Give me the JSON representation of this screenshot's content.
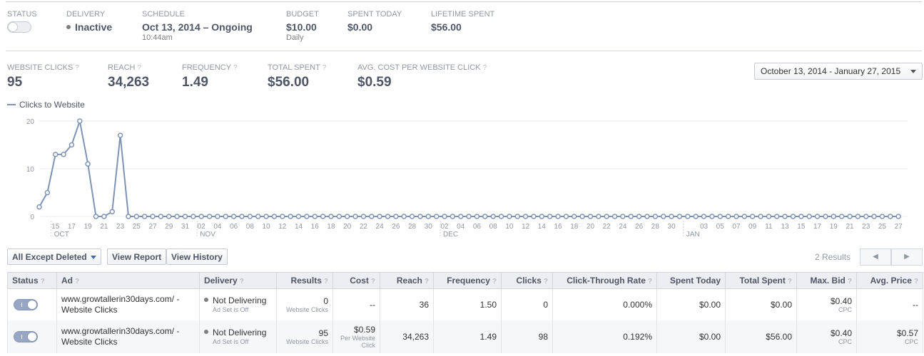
{
  "summary": {
    "status_label": "STATUS",
    "delivery_label": "DELIVERY",
    "delivery_value": "Inactive",
    "schedule_label": "SCHEDULE",
    "schedule_value": "Oct 13, 2014 – Ongoing",
    "schedule_time": "10:44am",
    "budget_label": "BUDGET",
    "budget_value": "$10.00",
    "budget_sub": "Daily",
    "spent_today_label": "SPENT TODAY",
    "spent_today_value": "$0.00",
    "lifetime_label": "LIFETIME SPENT",
    "lifetime_value": "$56.00"
  },
  "stats": [
    {
      "label": "WEBSITE CLICKS",
      "value": "95"
    },
    {
      "label": "REACH",
      "value": "34,263"
    },
    {
      "label": "FREQUENCY",
      "value": "1.49"
    },
    {
      "label": "TOTAL SPENT",
      "value": "$56.00"
    },
    {
      "label": "AVG. COST PER WEBSITE CLICK",
      "value": "$0.59"
    }
  ],
  "help_mark": "?",
  "date_range": "October 13, 2014 - January 27, 2015",
  "chart_data": {
    "type": "line",
    "series": [
      {
        "name": "Clicks to Website",
        "values": [
          2,
          5,
          13,
          13,
          15,
          20,
          11,
          0,
          0,
          1,
          17,
          0,
          0,
          0,
          0,
          0,
          0,
          0,
          0,
          0,
          0,
          0,
          0,
          0,
          0,
          0,
          0,
          0,
          0,
          0,
          0,
          0,
          0,
          0,
          0,
          0,
          0,
          0,
          0,
          0,
          0,
          0,
          0,
          0,
          0,
          0,
          0,
          0,
          0,
          0,
          0,
          0,
          0,
          0,
          0,
          0,
          0,
          0,
          0,
          0,
          0,
          0,
          0,
          0,
          0,
          0,
          0,
          0,
          0,
          0,
          0,
          0,
          0,
          0,
          0,
          0,
          0,
          0,
          0,
          0,
          0,
          0,
          0,
          0,
          0,
          0,
          0,
          0,
          0,
          0,
          0,
          0,
          0,
          0,
          0,
          0,
          0,
          0,
          0,
          0,
          0,
          0,
          0,
          0,
          0,
          0,
          0
        ]
      }
    ],
    "ylim": [
      0,
      20
    ],
    "yticks": [
      "0",
      "10",
      "20"
    ],
    "xticks": [
      "15",
      "17",
      "19",
      "21",
      "23",
      "25",
      "27",
      "29",
      "31",
      "02",
      "04",
      "06",
      "08",
      "10",
      "12",
      "14",
      "16",
      "18",
      "20",
      "22",
      "24",
      "26",
      "28",
      "30",
      "02",
      "04",
      "06",
      "08",
      "10",
      "12",
      "14",
      "16",
      "18",
      "20",
      "22",
      "24",
      "26",
      "28",
      "30",
      "",
      "03",
      "05",
      "07",
      "09",
      "11",
      "13",
      "15",
      "17",
      "19",
      "21",
      "23",
      "25",
      "27"
    ],
    "months": [
      {
        "label": "OCT",
        "tick": 0
      },
      {
        "label": "NOV",
        "tick": 9
      },
      {
        "label": "DEC",
        "tick": 24
      },
      {
        "label": "JAN",
        "tick": 39
      }
    ],
    "grid": true
  },
  "controls": {
    "filter": "All Except Deleted",
    "view_report": "View Report",
    "view_history": "View History",
    "results_count": "2 Results",
    "prev": "◀",
    "next": "▶"
  },
  "table": {
    "headers": [
      "Status",
      "Ad",
      "Delivery",
      "Results",
      "Cost",
      "Reach",
      "Frequency",
      "Clicks",
      "Click-Through Rate",
      "Spent Today",
      "Total Spent",
      "Max. Bid",
      "Avg. Price"
    ],
    "rows": [
      {
        "ad": "www.growtallerin30days.com/ - Website Clicks",
        "delivery": "Not Delivering",
        "delivery_sub": "Ad Set is Off",
        "results": "0",
        "results_sub": "Website Clicks",
        "cost": "--",
        "cost_sub": "",
        "reach": "36",
        "frequency": "1.50",
        "clicks": "0",
        "ctr": "0.000%",
        "spent_today": "$0.00",
        "total_spent": "$0.00",
        "max_bid": "$0.40",
        "max_bid_sub": "CPC",
        "avg_price": "--",
        "avg_price_sub": ""
      },
      {
        "ad": "www.growtallerin30days.com/ - Website Clicks",
        "delivery": "Not Delivering",
        "delivery_sub": "Ad Set is Off",
        "results": "95",
        "results_sub": "Website Clicks",
        "cost": "$0.59",
        "cost_sub": "Per Website Click",
        "reach": "34,263",
        "frequency": "1.49",
        "clicks": "98",
        "ctr": "0.192%",
        "spent_today": "$0.00",
        "total_spent": "$56.00",
        "max_bid": "$0.40",
        "max_bid_sub": "CPC",
        "avg_price": "$0.57",
        "avg_price_sub": "CPC"
      }
    ]
  },
  "colors": {
    "line": "#7f94b5",
    "grid": "#e9ebee",
    "axis_text": "#9197a3"
  }
}
